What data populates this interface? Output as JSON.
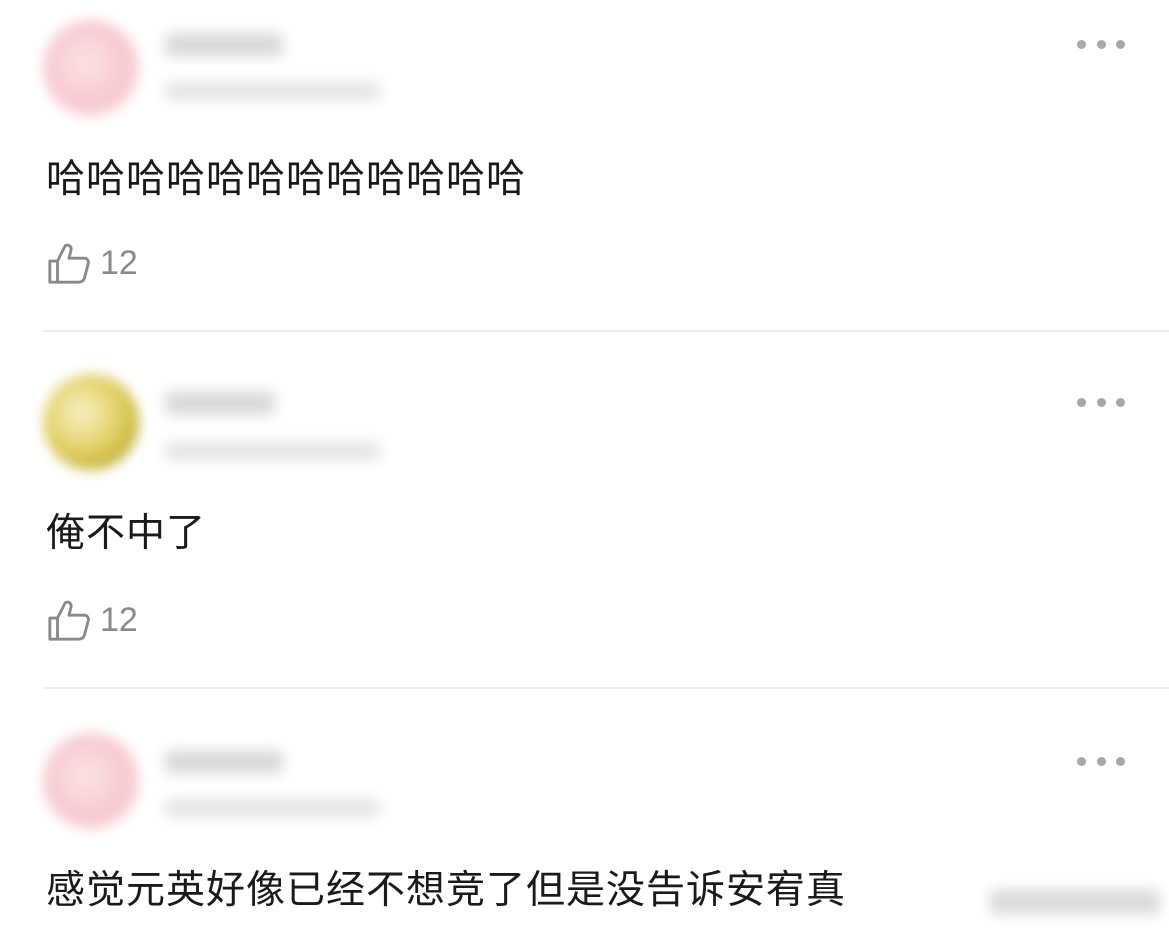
{
  "comments": [
    {
      "text": "哈哈哈哈哈哈哈哈哈哈哈哈",
      "likes": "12",
      "avatar_color": "#f6c9cf"
    },
    {
      "text": "俺不中了",
      "likes": "12",
      "avatar_color": "#e3d268"
    },
    {
      "text": "感觉元英好像已经不想竞了但是没告诉安宥真",
      "avatar_color": "#f6c9cf"
    }
  ],
  "icons": {
    "like": "thumbs-up-icon",
    "more": "more-dots-icon"
  },
  "colors": {
    "text": "#1a1a1a",
    "muted": "#8a8a8a",
    "divider": "#ececec"
  }
}
